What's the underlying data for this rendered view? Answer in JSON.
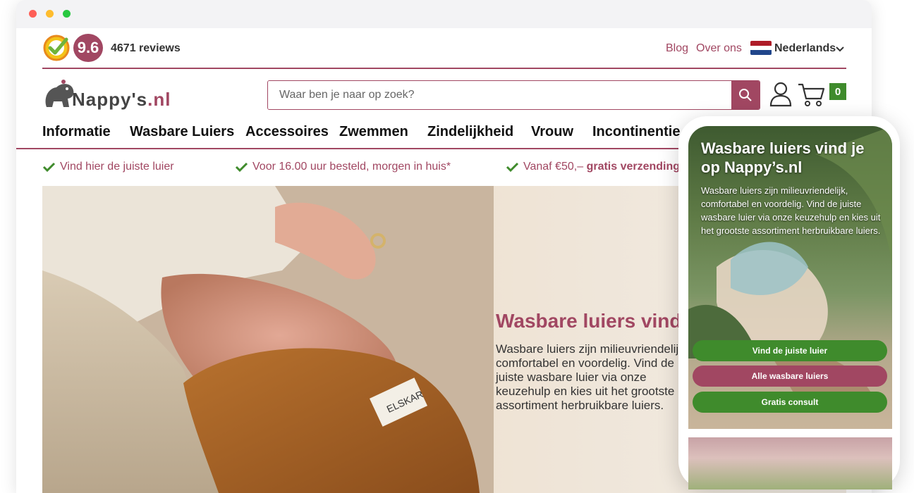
{
  "window": {
    "controls": [
      "close",
      "minimize",
      "maximize"
    ]
  },
  "rating": {
    "score": "9.6",
    "reviews": "4671 reviews"
  },
  "topnav": {
    "blog": "Blog",
    "about": "Over ons",
    "language": "Nederlands"
  },
  "logo": {
    "main": "Nappy's",
    "suffix": ".nl"
  },
  "search": {
    "placeholder": "Waar ben je naar op zoek?"
  },
  "cart": {
    "count": "0"
  },
  "nav": {
    "items": [
      "Informatie",
      "Wasbare Luiers",
      "Accessoires",
      "Zwemmen",
      "Zindelijkheid",
      "Vrouw",
      "Incontinentie"
    ]
  },
  "usps": {
    "item1": "Vind hier de juiste luier",
    "item2": "Voor 16.00 uur besteld, morgen in huis*",
    "item3_prefix": "Vanaf €50,– ",
    "item3_bold": "gratis verzending",
    "item3_suffix": "*"
  },
  "hero": {
    "title": "Wasbare luiers vind je op Nappy's.nl",
    "text": "Wasbare luiers zijn milieuvriendelijk, comfortabel en voordelig. Vind de juiste wasbare luier via onze keuzehulp en kies uit het grootste assortiment herbruikbare luiers."
  },
  "mobile": {
    "title": "Wasbare luiers vind je op Nappy’s.nl",
    "text": "Wasbare luiers zijn milieuvriendelijk, comfortabel en voordelig. Vind de juiste wasbare luier via onze keuzehulp en kies uit het grootste assortiment herbruikbare luiers.",
    "btn1": "Vind de juiste luier",
    "btn2": "Alle wasbare luiers",
    "btn3": "Gratis consult"
  },
  "colors": {
    "brand": "#a14762",
    "green": "#3f8b2c"
  }
}
